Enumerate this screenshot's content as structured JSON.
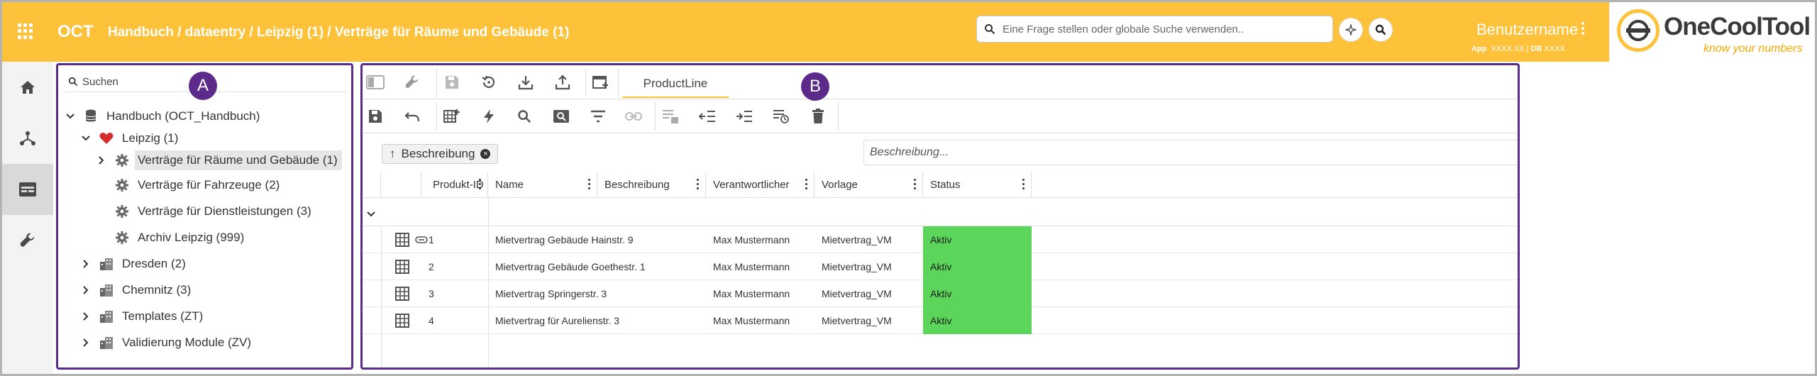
{
  "header": {
    "app_name": "OCT",
    "breadcrumb": "Handbuch / dataentry / Leipzig (1) / Verträge für Räume und Gebäude (1)",
    "search_placeholder": "Eine Frage stellen oder globale Suche verwenden..",
    "user_name": "Benutzername",
    "user_meta_app_label": "App",
    "user_meta_app_value": "XXXX.XX",
    "user_meta_db_label": "DB",
    "user_meta_db_value": "XXXX",
    "logo_text": "OneCoolTool",
    "logo_tagline": "know your numbers"
  },
  "colors": {
    "accent": "#fdc13a",
    "annotation": "#5c2a8a",
    "status_active": "#5bd65b"
  },
  "rail": {
    "items": [
      "home-icon",
      "hierarchy-icon",
      "dataentry-icon",
      "wrench-icon"
    ],
    "active_index": 2
  },
  "annotations": {
    "a": "A",
    "b": "B"
  },
  "tree": {
    "search_placeholder": "Suchen",
    "root": "Handbuch (OCT_Handbuch)",
    "leipzig": "Leipzig (1)",
    "leipzig_children": [
      "Verträge für Räume und Gebäude (1)",
      "Verträge für Fahrzeuge (2)",
      "Verträge für Dienstleistungen (3)",
      "Archiv Leipzig (999)"
    ],
    "others": [
      "Dresden (2)",
      "Chemnitz (3)",
      "Templates (ZT)",
      "Validierung Module (ZV)"
    ]
  },
  "toolbar": {
    "tab_label": "ProductLine",
    "description_placeholder": "Beschreibung..."
  },
  "sort": {
    "field": "Beschreibung",
    "arrow": "↑"
  },
  "grid": {
    "columns": [
      "Produkt-ID",
      "Name",
      "Beschreibung",
      "Verantwortlicher",
      "Vorlage",
      "Status"
    ],
    "rows": [
      {
        "id": "1",
        "name": "Mietvertrag Gebäude Hainstr. 9",
        "desc": "",
        "owner": "Max Mustermann",
        "template": "Mietvertrag_VM",
        "status": "Aktiv",
        "attachment": true
      },
      {
        "id": "2",
        "name": "Mietvertrag Gebäude Goethestr. 1",
        "desc": "",
        "owner": "Max Mustermann",
        "template": "Mietvertrag_VM",
        "status": "Aktiv",
        "attachment": false
      },
      {
        "id": "3",
        "name": "Mietvertrag Springerstr. 3",
        "desc": "",
        "owner": "Max Mustermann",
        "template": "Mietvertrag_VM",
        "status": "Aktiv",
        "attachment": false
      },
      {
        "id": "4",
        "name": "Mietvertrag für Aurelienstr. 3",
        "desc": "",
        "owner": "Max Mustermann",
        "template": "Mietvertrag_VM",
        "status": "Aktiv",
        "attachment": false
      }
    ]
  }
}
